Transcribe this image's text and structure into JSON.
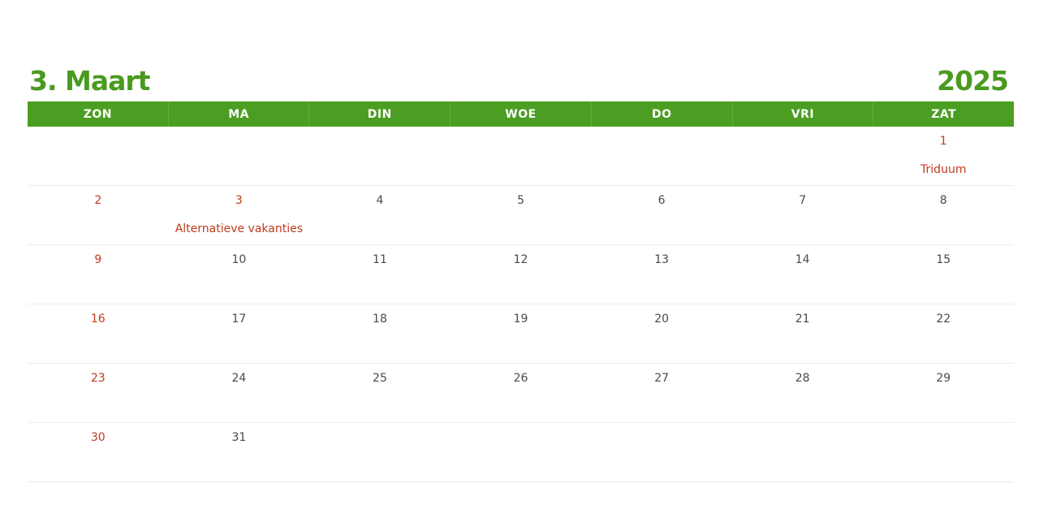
{
  "title": {
    "month": "3. Maart",
    "year": "2025"
  },
  "weekdays": [
    "ZON",
    "MA",
    "DIN",
    "WOE",
    "DO",
    "VRI",
    "ZAT"
  ],
  "colors": {
    "brand": "#4b9e22",
    "holiday": "#c0391b",
    "text": "#4a4a4a"
  },
  "weeks": [
    [
      {
        "num": "",
        "red": false,
        "event": ""
      },
      {
        "num": "",
        "red": false,
        "event": ""
      },
      {
        "num": "",
        "red": false,
        "event": ""
      },
      {
        "num": "",
        "red": false,
        "event": ""
      },
      {
        "num": "",
        "red": false,
        "event": ""
      },
      {
        "num": "",
        "red": false,
        "event": ""
      },
      {
        "num": "1",
        "red": true,
        "event": "Triduum"
      }
    ],
    [
      {
        "num": "2",
        "red": true,
        "event": ""
      },
      {
        "num": "3",
        "red": true,
        "event": "Alternatieve vakanties"
      },
      {
        "num": "4",
        "red": false,
        "event": ""
      },
      {
        "num": "5",
        "red": false,
        "event": ""
      },
      {
        "num": "6",
        "red": false,
        "event": ""
      },
      {
        "num": "7",
        "red": false,
        "event": ""
      },
      {
        "num": "8",
        "red": false,
        "event": ""
      }
    ],
    [
      {
        "num": "9",
        "red": true,
        "event": ""
      },
      {
        "num": "10",
        "red": false,
        "event": ""
      },
      {
        "num": "11",
        "red": false,
        "event": ""
      },
      {
        "num": "12",
        "red": false,
        "event": ""
      },
      {
        "num": "13",
        "red": false,
        "event": ""
      },
      {
        "num": "14",
        "red": false,
        "event": ""
      },
      {
        "num": "15",
        "red": false,
        "event": ""
      }
    ],
    [
      {
        "num": "16",
        "red": true,
        "event": ""
      },
      {
        "num": "17",
        "red": false,
        "event": ""
      },
      {
        "num": "18",
        "red": false,
        "event": ""
      },
      {
        "num": "19",
        "red": false,
        "event": ""
      },
      {
        "num": "20",
        "red": false,
        "event": ""
      },
      {
        "num": "21",
        "red": false,
        "event": ""
      },
      {
        "num": "22",
        "red": false,
        "event": ""
      }
    ],
    [
      {
        "num": "23",
        "red": true,
        "event": ""
      },
      {
        "num": "24",
        "red": false,
        "event": ""
      },
      {
        "num": "25",
        "red": false,
        "event": ""
      },
      {
        "num": "26",
        "red": false,
        "event": ""
      },
      {
        "num": "27",
        "red": false,
        "event": ""
      },
      {
        "num": "28",
        "red": false,
        "event": ""
      },
      {
        "num": "29",
        "red": false,
        "event": ""
      }
    ],
    [
      {
        "num": "30",
        "red": true,
        "event": ""
      },
      {
        "num": "31",
        "red": false,
        "event": ""
      },
      {
        "num": "",
        "red": false,
        "event": ""
      },
      {
        "num": "",
        "red": false,
        "event": ""
      },
      {
        "num": "",
        "red": false,
        "event": ""
      },
      {
        "num": "",
        "red": false,
        "event": ""
      },
      {
        "num": "",
        "red": false,
        "event": ""
      }
    ]
  ]
}
